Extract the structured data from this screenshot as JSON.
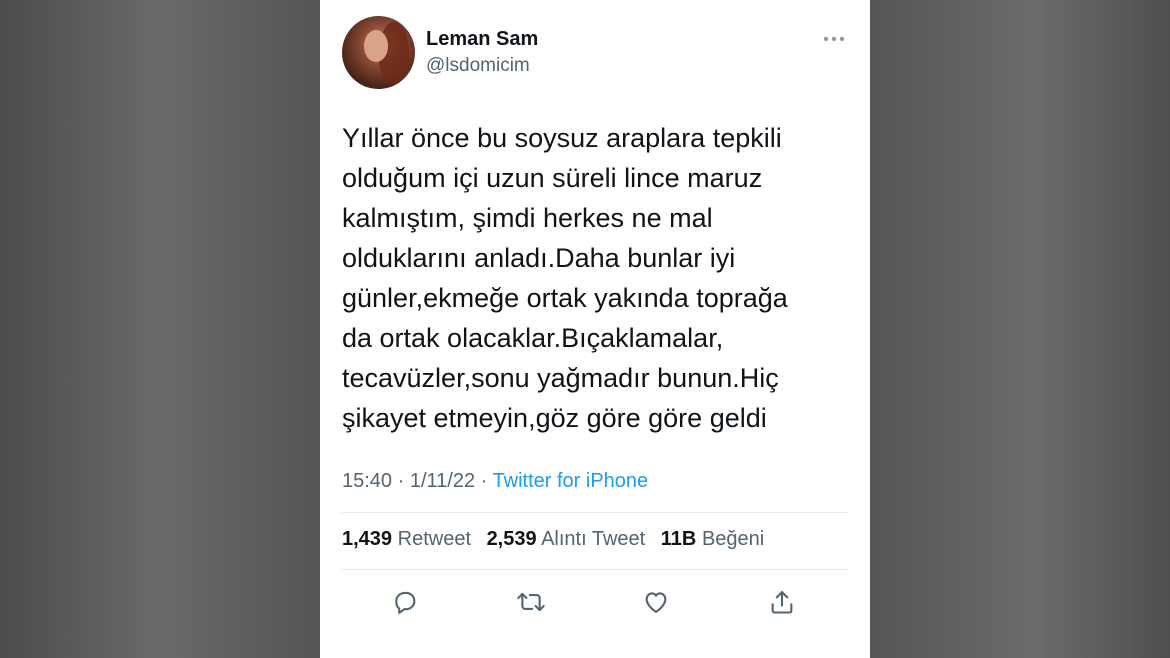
{
  "user": {
    "name": "Leman Sam",
    "handle": "@lsdomicim"
  },
  "tweet": {
    "text": "Yıllar önce bu soysuz araplara tepkili\nolduğum içi uzun süreli lince maruz\nkalmıştım, şimdi herkes ne mal\nolduklarını anladı.Daha bunlar iyi\ngünler,ekmeğe ortak yakında toprağa\nda ortak olacaklar.Bıçaklamalar,\ntecavüzler,sonu yağmadır bunun.Hiç\nşikayet etmeyin,göz göre göre geldi",
    "time": "15:40",
    "date": "1/11/22",
    "separator": "·",
    "source": "Twitter for iPhone"
  },
  "stats": {
    "retweets_count": "1,439",
    "retweets_label": "Retweet",
    "quotes_count": "2,539",
    "quotes_label": "Alıntı Tweet",
    "likes_count": "11B",
    "likes_label": "Beğeni"
  },
  "icons": {
    "more": "more-horizontal-icon",
    "reply": "reply-icon",
    "retweet": "retweet-icon",
    "like": "heart-icon",
    "share": "share-icon"
  },
  "colors": {
    "text": "#0f1419",
    "secondary": "#536471",
    "accent": "#1d9bf0",
    "divider": "#e6e9eb",
    "background_outer": "#5b5b5b"
  }
}
